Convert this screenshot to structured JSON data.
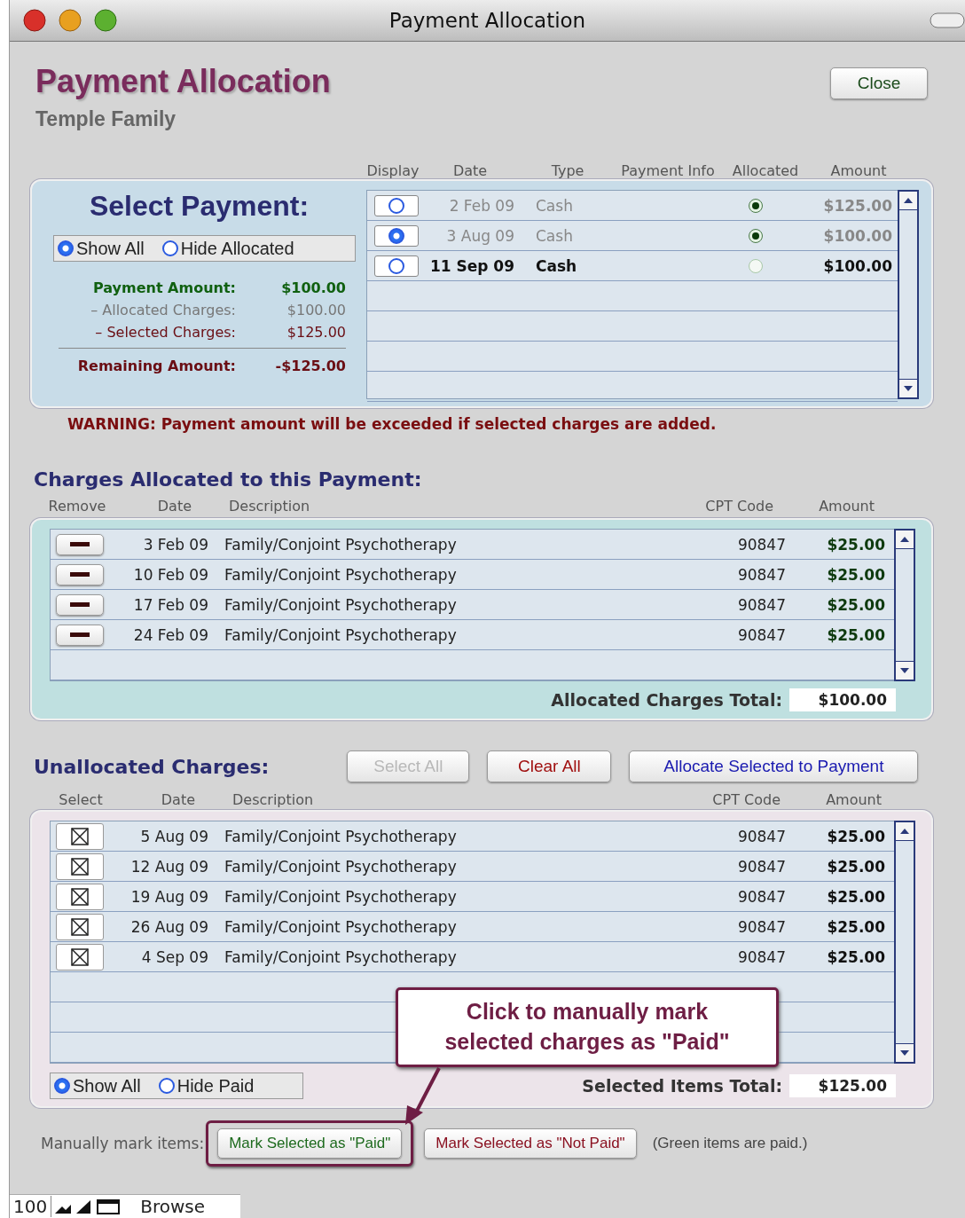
{
  "window": {
    "title": "Payment Allocation"
  },
  "header": {
    "title": "Payment Allocation",
    "subtitle": "Temple Family",
    "close_button": "Close"
  },
  "payments": {
    "heading": "Select Payment:",
    "columns": [
      "Display",
      "Date",
      "Type",
      "Payment Info",
      "Allocated",
      "Amount"
    ],
    "filter": [
      {
        "label": "Show All",
        "selected": true
      },
      {
        "label": "Hide Allocated",
        "selected": false
      }
    ],
    "summary": [
      {
        "kind": "payment",
        "label": "Payment Amount:",
        "value": "$100.00"
      },
      {
        "kind": "allocated",
        "label": "– Allocated Charges:",
        "value": "$100.00"
      },
      {
        "kind": "selected",
        "label": "– Selected Charges:",
        "value": "$125.00"
      },
      {
        "kind": "remaining",
        "label": "Remaining Amount:",
        "value": "-$125.00"
      }
    ],
    "rows": [
      {
        "selected": false,
        "date": "2 Feb 09",
        "type": "Cash",
        "allocated": true,
        "amount": "$125.00"
      },
      {
        "selected": true,
        "date": "3 Aug 09",
        "type": "Cash",
        "allocated": true,
        "amount": "$100.00"
      },
      {
        "selected": false,
        "date": "11 Sep 09",
        "type": "Cash",
        "allocated": false,
        "amount": "$100.00"
      }
    ]
  },
  "warning": "WARNING: Payment amount will be exceeded if selected charges are added.",
  "allocated_charges": {
    "heading": "Charges Allocated to this Payment:",
    "columns": [
      "Remove",
      "Date",
      "Description",
      "CPT Code",
      "Amount"
    ],
    "rows": [
      {
        "date": "3 Feb 09",
        "description": "Family/Conjoint Psychotherapy",
        "cpt_code": "90847",
        "amount": "$25.00"
      },
      {
        "date": "10 Feb 09",
        "description": "Family/Conjoint Psychotherapy",
        "cpt_code": "90847",
        "amount": "$25.00"
      },
      {
        "date": "17 Feb 09",
        "description": "Family/Conjoint Psychotherapy",
        "cpt_code": "90847",
        "amount": "$25.00"
      },
      {
        "date": "24 Feb 09",
        "description": "Family/Conjoint Psychotherapy",
        "cpt_code": "90847",
        "amount": "$25.00"
      }
    ],
    "total_label": "Allocated Charges Total:",
    "total": "$100.00"
  },
  "unallocated_charges": {
    "heading": "Unallocated Charges:",
    "buttons": [
      {
        "kind": "select_all",
        "label": "Select All",
        "disabled": true
      },
      {
        "kind": "clear",
        "label": "Clear All",
        "disabled": false
      },
      {
        "kind": "allocate",
        "label": "Allocate Selected to Payment",
        "disabled": false
      }
    ],
    "columns": [
      "Select",
      "Date",
      "Description",
      "CPT Code",
      "Amount"
    ],
    "rows": [
      {
        "checked": true,
        "date": "5 Aug 09",
        "description": "Family/Conjoint Psychotherapy",
        "cpt_code": "90847",
        "amount": "$25.00"
      },
      {
        "checked": true,
        "date": "12 Aug 09",
        "description": "Family/Conjoint Psychotherapy",
        "cpt_code": "90847",
        "amount": "$25.00"
      },
      {
        "checked": true,
        "date": "19 Aug 09",
        "description": "Family/Conjoint Psychotherapy",
        "cpt_code": "90847",
        "amount": "$25.00"
      },
      {
        "checked": true,
        "date": "26 Aug 09",
        "description": "Family/Conjoint Psychotherapy",
        "cpt_code": "90847",
        "amount": "$25.00"
      },
      {
        "checked": true,
        "date": "4 Sep 09",
        "description": "Family/Conjoint Psychotherapy",
        "cpt_code": "90847",
        "amount": "$25.00"
      }
    ],
    "filter": [
      {
        "label": "Show All",
        "selected": true
      },
      {
        "label": "Hide Paid",
        "selected": false
      }
    ],
    "total_label": "Selected Items Total:",
    "total": "$125.00"
  },
  "manual_mark": {
    "label": "Manually mark items:",
    "buttons": [
      {
        "kind": "paid",
        "label": "Mark Selected as \"Paid\"",
        "highlighted": true
      },
      {
        "kind": "not_paid",
        "label": "Mark Selected as \"Not Paid\"",
        "highlighted": false
      }
    ],
    "note": "(Green items are paid.)"
  },
  "callout": {
    "text": "Click to manually mark selected charges as \"Paid\""
  },
  "status_bar": {
    "zoom": "100",
    "mode": "Browse"
  }
}
